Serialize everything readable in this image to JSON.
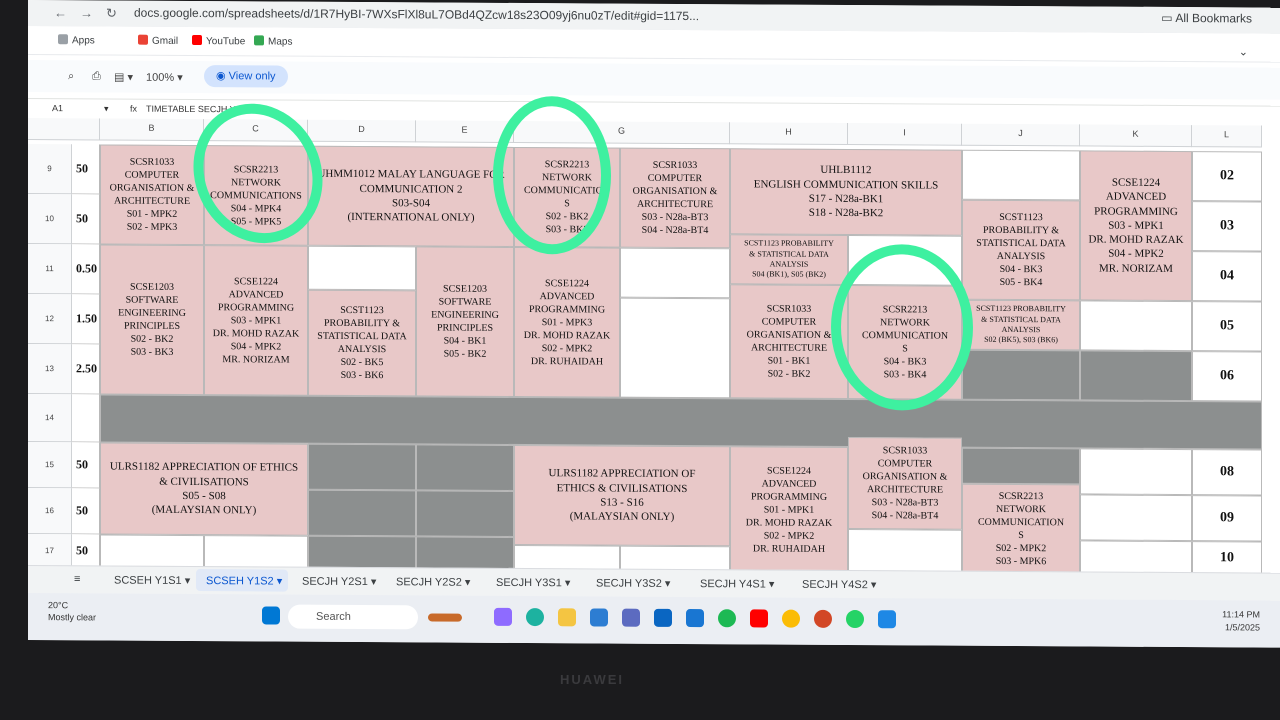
{
  "browser": {
    "url": "docs.google.com/spreadsheets/d/1R7HyBI-7WXsFlXl8uL7OBd4QZcw18s23O09yj6nu0zT/edit#gid=1175...",
    "all_bookmarks": "All Bookmarks",
    "bookmarks": [
      "Apps",
      "Gmail",
      "YouTube",
      "Maps"
    ]
  },
  "toolbar": {
    "zoom": "100%",
    "view_only": "View only",
    "cell_ref": "A1",
    "formula": "TIMETABLE SECJH Y1S2"
  },
  "columns": [
    "B",
    "C",
    "D",
    "E",
    "G",
    "H",
    "I",
    "J",
    "K",
    "L"
  ],
  "rows": [
    "9",
    "10",
    "11",
    "12",
    "13",
    "14",
    "15",
    "16",
    "17"
  ],
  "times": [
    "50",
    "50",
    "0.50",
    "1.50",
    "2.50",
    "50",
    "50",
    "50"
  ],
  "slots": [
    "02",
    "03",
    "04",
    "05",
    "06",
    "08",
    "09",
    "10"
  ],
  "cells": {
    "c1": [
      "SCSR1033",
      "COMPUTER",
      "ORGANISATION &",
      "ARCHITECTURE",
      "S01 - MPK2",
      "S02 - MPK3"
    ],
    "c2": [
      "SCSR2213",
      "NETWORK",
      "COMMUNICATIONS",
      "S04 - MPK4",
      "S05 - MPK5"
    ],
    "c3": [
      "UHMM1012 MALAY LANGUAGE FOR",
      "COMMUNICATION 2",
      "S03-S04",
      "(INTERNATIONAL ONLY)"
    ],
    "c4": [
      "SCSR2213",
      "NETWORK",
      "COMMUNICATION",
      "S",
      "S02 - BK2",
      "S03 - BK3"
    ],
    "c5": [
      "SCSR1033",
      "COMPUTER",
      "ORGANISATION &",
      "ARCHITECTURE",
      "S03 - N28a-BT3",
      "S04 - N28a-BT4"
    ],
    "c6": [
      "UHLB1112",
      "ENGLISH COMMUNICATION SKILLS",
      "S17 - N28a-BK1",
      "S18 - N28a-BK2"
    ],
    "c7": [
      "SCSE1224",
      "ADVANCED",
      "PROGRAMMING",
      "S03 - MPK1",
      "DR. MOHD RAZAK",
      "S04 - MPK2",
      "MR. NORIZAM"
    ],
    "c8": [
      "SCST1123",
      "PROBABILITY &",
      "STATISTICAL DATA",
      "ANALYSIS",
      "S04 - BK3",
      "S05 - BK4"
    ],
    "c9": [
      "SCST1123 PROBABILITY",
      "& STATISTICAL DATA",
      "ANALYSIS",
      "S04 (BK1), S05 (BK2)"
    ],
    "c10": [
      "SCSE1203",
      "SOFTWARE",
      "ENGINEERING",
      "PRINCIPLES",
      "S02 - BK2",
      "S03 - BK3"
    ],
    "c11": [
      "SCSE1224",
      "ADVANCED",
      "PROGRAMMING",
      "S03 - MPK1",
      "DR. MOHD RAZAK",
      "S04 - MPK2",
      "MR. NORIZAM"
    ],
    "c12": [
      "SCST1123",
      "PROBABILITY &",
      "STATISTICAL DATA",
      "ANALYSIS",
      "S02 - BK5",
      "S03 - BK6"
    ],
    "c13": [
      "SCSE1203",
      "SOFTWARE",
      "ENGINEERING",
      "PRINCIPLES",
      "S04 - BK1",
      "S05 - BK2"
    ],
    "c14": [
      "SCSE1224",
      "ADVANCED",
      "PROGRAMMING",
      "S01 - MPK3",
      "DR. MOHD RAZAK",
      "S02 - MPK2",
      "DR. RUHAIDAH"
    ],
    "c15": [
      "SCSR1033",
      "COMPUTER",
      "ORGANISATION &",
      "ARCHITECTURE",
      "S01 - BK1",
      "S02 - BK2"
    ],
    "c16": [
      "SCSR2213",
      "NETWORK",
      "COMMUNICATION",
      "S",
      "S04 - BK3",
      "S03 - BK4"
    ],
    "c17": [
      "SCST1123 PROBABILITY",
      "& STATISTICAL DATA",
      "ANALYSIS",
      "S02 (BK5), S03 (BK6)"
    ],
    "c18": [
      "ULRS1182 APPRECIATION OF ETHICS",
      "& CIVILISATIONS",
      "S05 - S08",
      "(MALAYSIAN ONLY)"
    ],
    "c19": [
      "ULRS1182 APPRECIATION OF",
      "ETHICS & CIVILISATIONS",
      "S13 - S16",
      "(MALAYSIAN ONLY)"
    ],
    "c20": [
      "SCSE1224",
      "ADVANCED",
      "PROGRAMMING",
      "S01 - MPK1",
      "DR. MOHD RAZAK",
      "S02 - MPK2",
      "DR. RUHAIDAH"
    ],
    "c21": [
      "SCSR1033",
      "COMPUTER",
      "ORGANISATION &",
      "ARCHITECTURE",
      "S03 - N28a-BT3",
      "S04 - N28a-BT4"
    ],
    "c22": [
      "SCSR2213",
      "NETWORK",
      "COMMUNICATION",
      "S",
      "S02 - MPK2",
      "S03 - MPK6"
    ]
  },
  "tabs": [
    "SCSEH Y1S1",
    "SCSEH Y1S2",
    "SECJH Y2S1",
    "SECJH Y2S2",
    "SECJH Y3S1",
    "SECJH Y3S2",
    "SECJH Y4S1",
    "SECJH Y4S2"
  ],
  "active_tab": "SCSEH Y1S2",
  "taskbar": {
    "weather_temp": "20°C",
    "weather_desc": "Mostly clear",
    "search": "Search",
    "time": "11:14 PM",
    "date": "1/5/2025"
  },
  "device_brand": "HUAWEI",
  "colors": {
    "pink": "#e8c8c8",
    "gray": "#8c8f8f",
    "highlight_ring": "#3ef0a0",
    "accent": "#0b57d0"
  }
}
